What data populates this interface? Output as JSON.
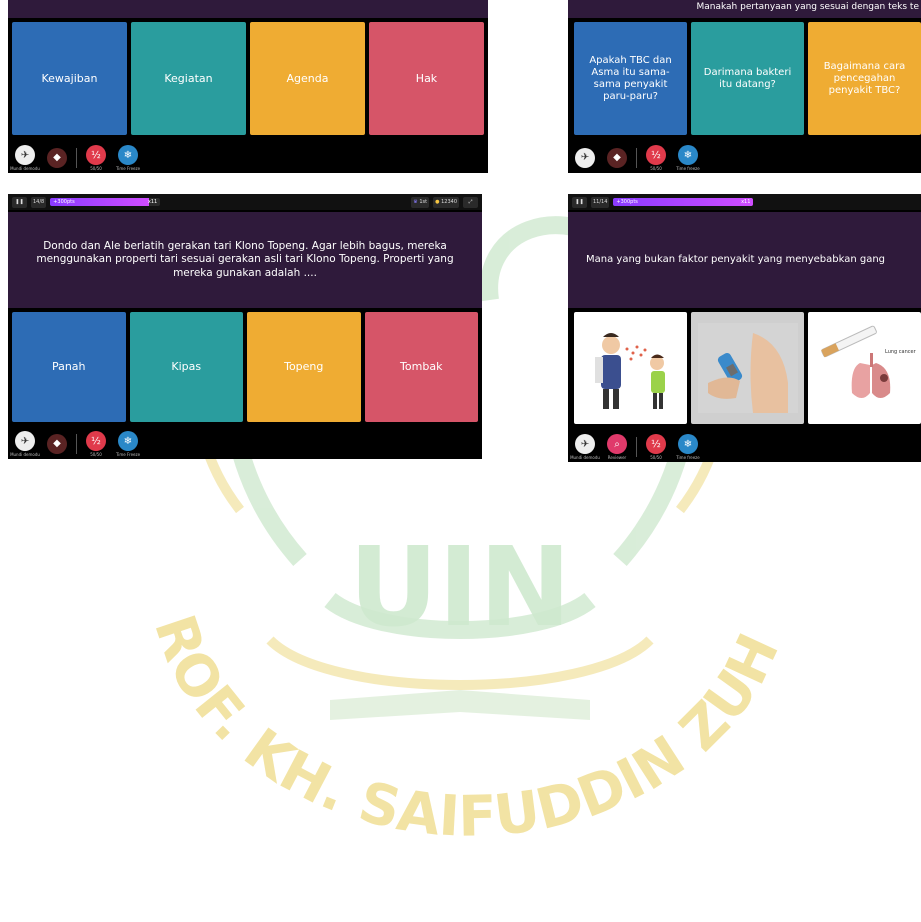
{
  "colors": {
    "question_bg": "#2f1a3b",
    "blue": "#2d6cb5",
    "teal": "#2a9d9e",
    "orange": "#efac33",
    "red": "#d65568",
    "watermark_green": "#bfe3bf",
    "watermark_yellow": "#f2e3a0"
  },
  "watermark": {
    "center_text": "UIN",
    "arc_text": "PROF. KH. SAIFUDDIN ZUHRI"
  },
  "panel_a": {
    "options": [
      "Kewajiban",
      "Kegiatan",
      "Agenda",
      "Hak"
    ],
    "powerups": [
      {
        "icon": "plane-icon",
        "label": "Mundi demodu"
      },
      {
        "icon": "eraser-icon",
        "label": ""
      },
      {
        "icon": "fifty-icon",
        "label": "50/50"
      },
      {
        "icon": "freeze-icon",
        "label": "Time Freeze"
      }
    ]
  },
  "panel_b": {
    "question": "Manakah pertanyaan yang sesuai dengan teks te",
    "options": [
      "Apakah TBC dan Asma itu sama-sama penyakit paru-paru?",
      "Darimana bakteri itu datang?",
      "Bagaimana cara pencegahan penyakit TBC?"
    ],
    "powerups": [
      {
        "icon": "plane-icon",
        "label": ""
      },
      {
        "icon": "eraser-icon",
        "label": ""
      },
      {
        "icon": "fifty-icon",
        "label": "50/50"
      },
      {
        "icon": "freeze-icon",
        "label": "Time freeze"
      }
    ]
  },
  "panel_c": {
    "counter": "14/8",
    "progress_label": "+300pts",
    "progress_right": "x11",
    "progress_fraction": 0.9,
    "rank": "1st",
    "score": "12340",
    "question": "Dondo dan Ale berlatih gerakan tari Klono Topeng. Agar lebih bagus, mereka menggunakan properti tari sesuai gerakan asli tari Klono Topeng. Properti yang mereka gunakan adalah ....",
    "options": [
      "Panah",
      "Kipas",
      "Topeng",
      "Tombak"
    ],
    "powerups": [
      {
        "icon": "plane-icon",
        "label": "Mundi demodu"
      },
      {
        "icon": "eraser-icon",
        "label": ""
      },
      {
        "icon": "fifty-icon",
        "label": "50/50"
      },
      {
        "icon": "freeze-icon",
        "label": "Time Freeze"
      }
    ]
  },
  "panel_d": {
    "counter": "11/14",
    "progress_label": "+300pts",
    "progress_right": "x11",
    "progress_fraction": 1.0,
    "question": "Mana yang bukan faktor penyakit yang menyebabkan gang",
    "image_options": [
      "sneeze-image",
      "inhaler-image",
      "cigarette-lung-image"
    ],
    "lung_caption": "Lung cancer",
    "powerups": [
      {
        "icon": "plane-icon",
        "label": "Mundi demodu"
      },
      {
        "icon": "search-icon",
        "label": "Reviewer"
      },
      {
        "icon": "fifty-icon",
        "label": "50/50"
      },
      {
        "icon": "freeze-icon",
        "label": "Time freeze"
      }
    ]
  }
}
